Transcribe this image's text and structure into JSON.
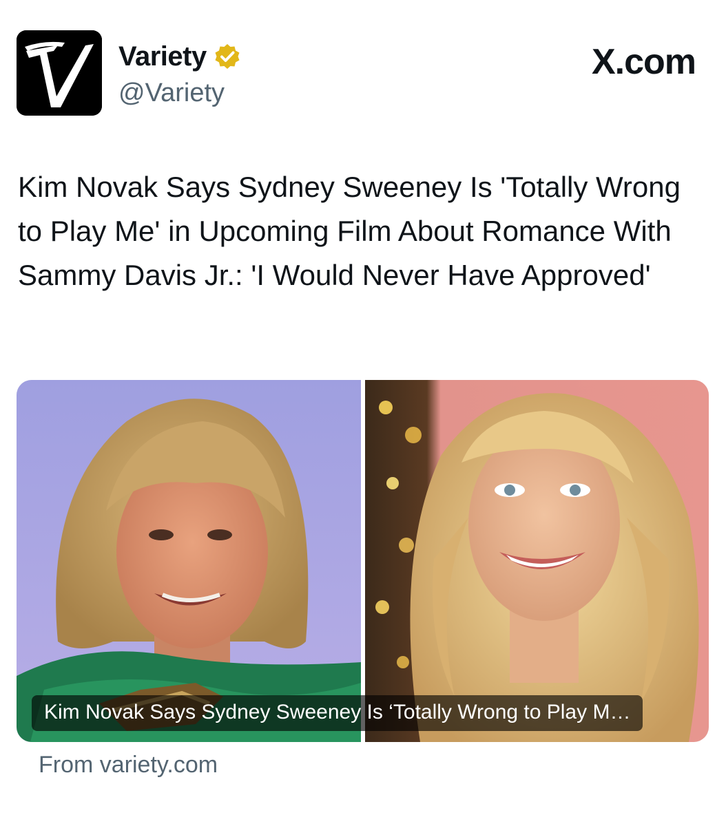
{
  "author": {
    "display_name": "Variety",
    "handle": "@Variety",
    "avatar_letter": "V",
    "verified_color": "#E2B719"
  },
  "brand": "X.com",
  "post": {
    "headline": "Kim Novak Says Sydney Sweeney Is 'Totally Wrong to Play Me' in Upcoming Film About Romance With Sammy Davis Jr.: 'I Would Never Have Approved'"
  },
  "card": {
    "caption": "Kim Novak Says Sydney Sweeney Is ‘Totally Wrong to Play M…",
    "source": "From variety.com",
    "left_photo": "photo-of-older-woman-with-blonde-bob",
    "right_photo": "photo-of-young-woman-with-long-blonde-hair"
  }
}
